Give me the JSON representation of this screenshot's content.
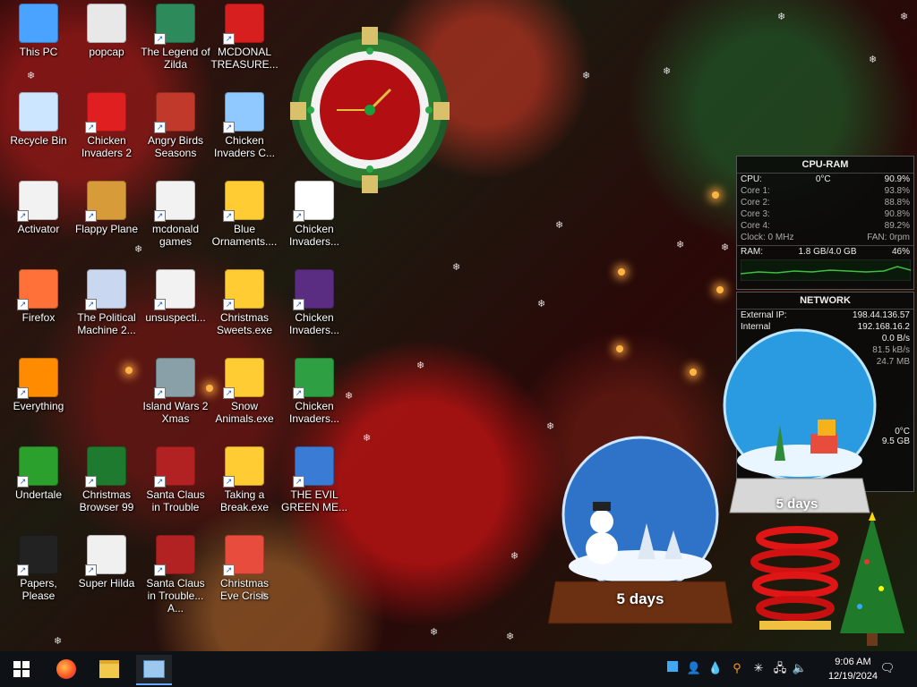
{
  "desktop": {
    "icons": [
      {
        "label": "This PC",
        "icon": "monitor-icon",
        "color": "#4aa3ff"
      },
      {
        "label": "popcap",
        "icon": "folder-icon",
        "color": "#e8e8e8"
      },
      {
        "label": "The Legend of Zilda",
        "icon": "game-icon",
        "color": "#2d8a5a"
      },
      {
        "label": "MCDONAL TREASURE...",
        "icon": "mcdonalds-icon",
        "color": "#d71f1f"
      },
      {
        "label": "Recycle Bin",
        "icon": "recycle-bin-icon",
        "color": "#cde6ff"
      },
      {
        "label": "Chicken Invaders 2",
        "icon": "chicken-icon",
        "color": "#e02020"
      },
      {
        "label": "Angry Birds Seasons",
        "icon": "angry-birds-icon",
        "color": "#c0392b"
      },
      {
        "label": "Chicken Invaders C...",
        "icon": "chicken-icon",
        "color": "#8fc9ff"
      },
      {
        "label": "Activator",
        "icon": "file-icon",
        "color": "#f2f2f2"
      },
      {
        "label": "Flappy Plane",
        "icon": "plane-icon",
        "color": "#d89b3a"
      },
      {
        "label": "mcdonald games",
        "icon": "file-icon",
        "color": "#f2f2f2"
      },
      {
        "label": "Blue Ornaments....",
        "icon": "shortcut-exe-icon",
        "color": "#ffcc33"
      },
      {
        "label": "Chicken Invaders...",
        "icon": "chicken-icon",
        "color": "#ffffff"
      },
      {
        "label": "Firefox",
        "icon": "firefox-icon",
        "color": "#ff7139"
      },
      {
        "label": "The Political Machine 2...",
        "icon": "political-machine-icon",
        "color": "#c9d8f0"
      },
      {
        "label": "unsuspecti...",
        "icon": "file-icon",
        "color": "#f2f2f2"
      },
      {
        "label": "Christmas Sweets.exe",
        "icon": "shortcut-exe-icon",
        "color": "#ffcc33"
      },
      {
        "label": "Chicken Invaders...",
        "icon": "chicken-icon",
        "color": "#5a2d82"
      },
      {
        "label": "Everything",
        "icon": "search-icon",
        "color": "#ff8c00"
      },
      {
        "label": "Island Wars 2 Xmas",
        "icon": "island-icon",
        "color": "#8aa0a8"
      },
      {
        "label": "Snow Animals.exe",
        "icon": "shortcut-exe-icon",
        "color": "#ffcc33"
      },
      {
        "label": "Chicken Invaders...",
        "icon": "chicken-icon",
        "color": "#2ea043"
      },
      {
        "label": "Undertale",
        "icon": "undertale-icon",
        "color": "#2ca02c"
      },
      {
        "label": "Christmas Browser 99",
        "icon": "christmas-tree-icon",
        "color": "#1e7a2e"
      },
      {
        "label": "Santa Claus in Trouble",
        "icon": "santa-icon",
        "color": "#b22222"
      },
      {
        "label": "Taking a Break.exe",
        "icon": "shortcut-exe-icon",
        "color": "#ffcc33"
      },
      {
        "label": "THE EVIL GREEN ME...",
        "icon": "messenger-icon",
        "color": "#3a7bd5"
      },
      {
        "label": "Papers, Please",
        "icon": "papers-please-icon",
        "color": "#222222"
      },
      {
        "label": "Super Hilda",
        "icon": "pixel-game-icon",
        "color": "#f0f0f0"
      },
      {
        "label": "Santa Claus in Trouble... A...",
        "icon": "santa-icon",
        "color": "#b22222"
      },
      {
        "label": "Christmas Eve Crisis",
        "icon": "santa-icon",
        "color": "#e74c3c"
      }
    ]
  },
  "cpu_ram": {
    "title": "CPU-RAM",
    "cpu_label": "CPU:",
    "cpu_temp": "0°C",
    "cpu_usage": "90.9%",
    "cores": [
      {
        "label": "Core 1:",
        "value": "93.8%"
      },
      {
        "label": "Core 2:",
        "value": "88.8%"
      },
      {
        "label": "Core 3:",
        "value": "90.8%"
      },
      {
        "label": "Core 4:",
        "value": "89.2%"
      }
    ],
    "clock": "Clock: 0 MHz",
    "fan": "FAN: 0rpm",
    "ram_label": "RAM:",
    "ram_value": "1.8 GB/4.0 GB",
    "ram_pct": "46%"
  },
  "network": {
    "title": "NETWORK",
    "rows": [
      {
        "label": "External IP:",
        "value": "198.44.136.57"
      },
      {
        "label": "Internal",
        "value": "192.168.16.2"
      },
      {
        "label": "",
        "value": "0.0 B/s"
      },
      {
        "label": "",
        "value": "81.5 kB/s"
      },
      {
        "label": "",
        "value": "24.7 MB"
      }
    ],
    "extra_temp": "0°C",
    "extra_size": "9.5 GB"
  },
  "globes": [
    {
      "countdown": "5 days"
    },
    {
      "countdown": "5 days"
    }
  ],
  "taskbar": {
    "time": "9:06 AM",
    "date": "12/19/2024"
  }
}
